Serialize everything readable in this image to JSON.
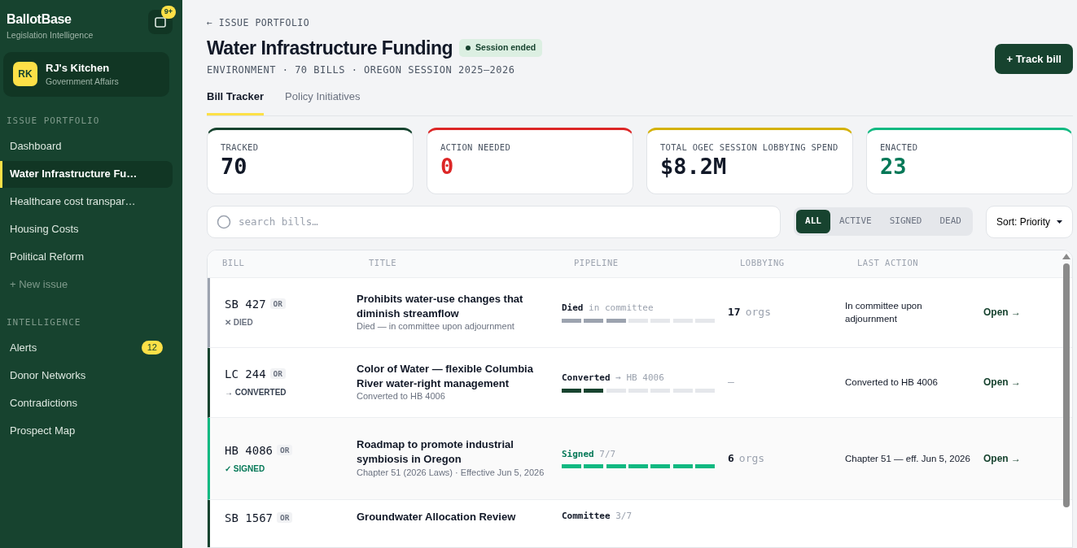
{
  "sidebar": {
    "brand": "BallotBase",
    "tagline": "Legislation Intelligence",
    "notification_badge": "9+",
    "account": {
      "initials": "RK",
      "name": "RJ's Kitchen",
      "role": "Government Affairs"
    },
    "sections": [
      {
        "heading": "ISSUE PORTFOLIO",
        "items": [
          {
            "label": "Dashboard",
            "selected": false,
            "kind": "link"
          },
          {
            "label": "Water Infrastructure Fu…",
            "selected": true,
            "kind": "link"
          },
          {
            "label": "Healthcare cost transpar…",
            "selected": false,
            "kind": "link"
          },
          {
            "label": "Housing Costs",
            "selected": false,
            "kind": "link"
          },
          {
            "label": "Political Reform",
            "selected": false,
            "kind": "link"
          },
          {
            "label": "+ New issue",
            "selected": false,
            "kind": "add"
          }
        ]
      },
      {
        "heading": "INTELLIGENCE",
        "items": [
          {
            "label": "Alerts",
            "selected": false,
            "kind": "link",
            "badge": "12"
          },
          {
            "label": "Donor Networks",
            "selected": false,
            "kind": "link"
          },
          {
            "label": "Contradictions",
            "selected": false,
            "kind": "link"
          },
          {
            "label": "Prospect Map",
            "selected": false,
            "kind": "link"
          }
        ]
      }
    ]
  },
  "header": {
    "back_link": "← ISSUE PORTFOLIO",
    "title": "Water Infrastructure Funding",
    "status_pill": "Session ended",
    "meta": "ENVIRONMENT · 70 BILLS · OREGON SESSION 2025–2026",
    "primary_button": "+ Track bill"
  },
  "tabs": [
    {
      "label": "Bill Tracker",
      "selected": true
    },
    {
      "label": "Policy Initiatives",
      "selected": false
    }
  ],
  "stats": [
    {
      "label": "TRACKED",
      "value": "70",
      "color": "#17432f",
      "kind": "plain"
    },
    {
      "label": "ACTION NEEDED",
      "value": "0",
      "color": "#dc2626",
      "kind": "alert"
    },
    {
      "label": "TOTAL OGEC SESSION LOBBYING SPEND",
      "value": "$8.2M",
      "color": "#d4b106",
      "kind": "plain"
    },
    {
      "label": "ENACTED",
      "value": "23",
      "color": "#10b981",
      "kind": "good"
    }
  ],
  "search": {
    "placeholder": "search bills…"
  },
  "filters": [
    {
      "label": "ALL",
      "selected": true
    },
    {
      "label": "ACTIVE",
      "selected": false
    },
    {
      "label": "SIGNED",
      "selected": false
    },
    {
      "label": "DEAD",
      "selected": false
    }
  ],
  "sort": {
    "label": "Sort: Priority"
  },
  "table": {
    "columns": [
      "BILL",
      "TITLE",
      "PIPELINE",
      "LOBBYING",
      "LAST ACTION"
    ],
    "rows": [
      {
        "bill": "SB 427",
        "state": "OR",
        "kind": "died",
        "status_label": "✕ DIED",
        "title": "Prohibits water-use changes that diminish streamflow",
        "subtitle": "Died — in committee upon adjournment",
        "stage": "Died",
        "stage_detail": "in committee",
        "level": 0.43,
        "lobby_count": "17",
        "lobby_unit": "orgs",
        "last_action": "In committee upon adjournment",
        "link": "Open →"
      },
      {
        "bill": "LC 244",
        "state": "OR",
        "kind": "converted",
        "status_label": "→ CONVERTED",
        "title": "Color of Water — flexible Columbia River water-right management",
        "subtitle": "Converted to HB 4006",
        "stage": "Converted",
        "stage_detail": "→ HB 4006",
        "level": 0.29,
        "lobby_count": "—",
        "last_action": "Converted to HB 4006",
        "link": "Open →"
      },
      {
        "bill": "HB 4086",
        "state": "OR",
        "kind": "signed",
        "status_label": "✓ SIGNED",
        "title": "Roadmap to promote industrial symbiosis in Oregon",
        "subtitle": "Chapter 51 (2026 Laws) · Effective Jun 5, 2026",
        "stage": "Signed",
        "stage_detail": "7/7",
        "level": 1,
        "lobby_count": "6",
        "lobby_unit": "orgs",
        "last_action": "Chapter 51 — eff. Jun 5, 2026",
        "link": "Open →"
      },
      {
        "bill": "SB 1567",
        "state": "OR",
        "kind": "active",
        "title": "Groundwater Allocation Review",
        "stage": "Committee",
        "stage_detail": "3/7"
      }
    ]
  }
}
